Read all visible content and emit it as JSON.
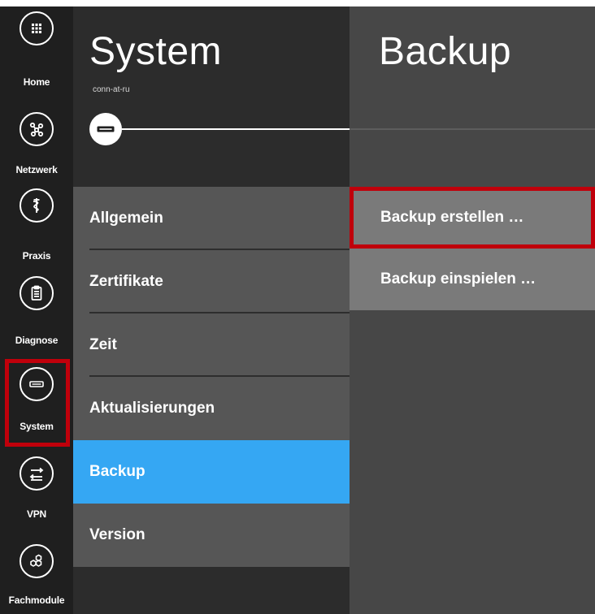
{
  "rail": {
    "items": [
      {
        "label": "Home",
        "icon": "grid-icon"
      },
      {
        "label": "Netzwerk",
        "icon": "network-icon"
      },
      {
        "label": "Praxis",
        "icon": "caduceus-icon"
      },
      {
        "label": "Diagnose",
        "icon": "clipboard-icon"
      },
      {
        "label": "System",
        "icon": "device-icon"
      },
      {
        "label": "VPN",
        "icon": "vpn-icon"
      },
      {
        "label": "Fachmodule",
        "icon": "hexagons-icon"
      }
    ],
    "selected": "System"
  },
  "system_panel": {
    "title": "System",
    "subtitle": "conn-at-ru",
    "device_icon": "device-icon",
    "menu": [
      {
        "label": "Allgemein"
      },
      {
        "label": "Zertifikate"
      },
      {
        "label": "Zeit"
      },
      {
        "label": "Aktualisierungen"
      },
      {
        "label": "Backup"
      },
      {
        "label": "Version"
      }
    ],
    "active_item": "Backup"
  },
  "backup_panel": {
    "title": "Backup",
    "actions": [
      {
        "label": "Backup erstellen …"
      },
      {
        "label": "Backup einspielen …"
      }
    ],
    "highlighted_action": "Backup erstellen …"
  },
  "colors": {
    "rail_bg": "#1f1f1f",
    "middle_bg": "#2c2c2c",
    "right_bg": "#474747",
    "menu_bg": "#565656",
    "active_blue": "#35a7f3",
    "highlight_red": "#c0000b"
  }
}
